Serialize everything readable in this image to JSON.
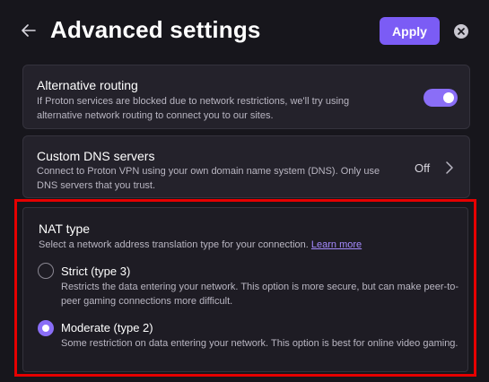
{
  "header": {
    "title": "Advanced settings",
    "apply_label": "Apply"
  },
  "alternative_routing": {
    "title": "Alternative routing",
    "description": "If Proton services are blocked due to network restrictions, we'll try using alternative network routing to connect you to our sites.",
    "enabled": true
  },
  "custom_dns": {
    "title": "Custom DNS servers",
    "description": "Connect to Proton VPN using your own domain name system (DNS). Only use DNS servers that you trust.",
    "status": "Off"
  },
  "nat": {
    "title": "NAT type",
    "description": "Select a network address translation type for your connection.",
    "learn_more": "Learn more",
    "options": [
      {
        "label": "Strict (type 3)",
        "description": "Restricts the data entering your network. This option is more secure, but can make peer-to-peer gaming connections more difficult.",
        "selected": false
      },
      {
        "label": "Moderate (type 2)",
        "description": "Some restriction on data entering your network. This option is best for online video gaming.",
        "selected": true
      }
    ]
  },
  "colors": {
    "accent": "#7b5cf5",
    "highlight_border": "#e60000"
  }
}
